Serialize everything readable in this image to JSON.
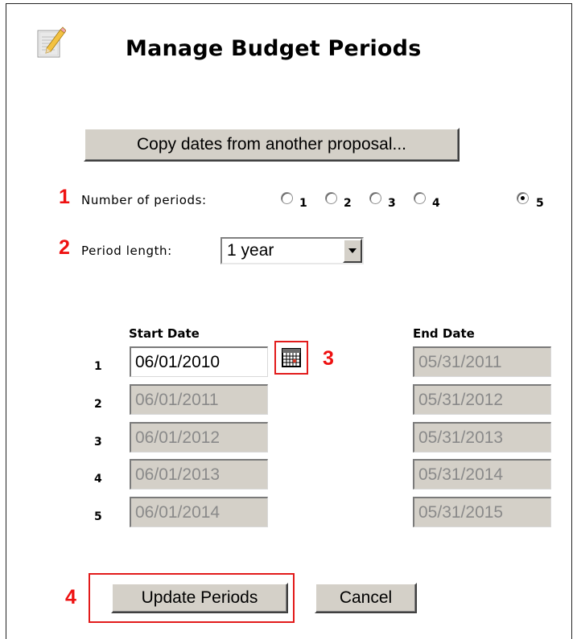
{
  "header": {
    "title": "Manage Budget Periods",
    "icon": "edit-pencil-icon"
  },
  "copy_button_label": "Copy dates from another proposal...",
  "callouts": {
    "one": "1",
    "two": "2",
    "three": "3",
    "four": "4"
  },
  "periods": {
    "label": "Number of periods:",
    "options": [
      "1",
      "2",
      "3",
      "4",
      "5"
    ],
    "selected": "5"
  },
  "period_length": {
    "label": "Period length:",
    "value": "1 year"
  },
  "table": {
    "start_header": "Start Date",
    "end_header": "End Date",
    "rows": [
      {
        "num": "1",
        "start": "06/01/2010",
        "end": "05/31/2011"
      },
      {
        "num": "2",
        "start": "06/01/2011",
        "end": "05/31/2012"
      },
      {
        "num": "3",
        "start": "06/01/2012",
        "end": "05/31/2013"
      },
      {
        "num": "4",
        "start": "06/01/2013",
        "end": "05/31/2014"
      },
      {
        "num": "5",
        "start": "06/01/2014",
        "end": "05/31/2015"
      }
    ]
  },
  "footer": {
    "update_label": "Update Periods",
    "cancel_label": "Cancel"
  },
  "colors": {
    "callout": "#ee1111",
    "button_face": "#d4d0c8",
    "disabled_text": "#8a8a8a"
  }
}
